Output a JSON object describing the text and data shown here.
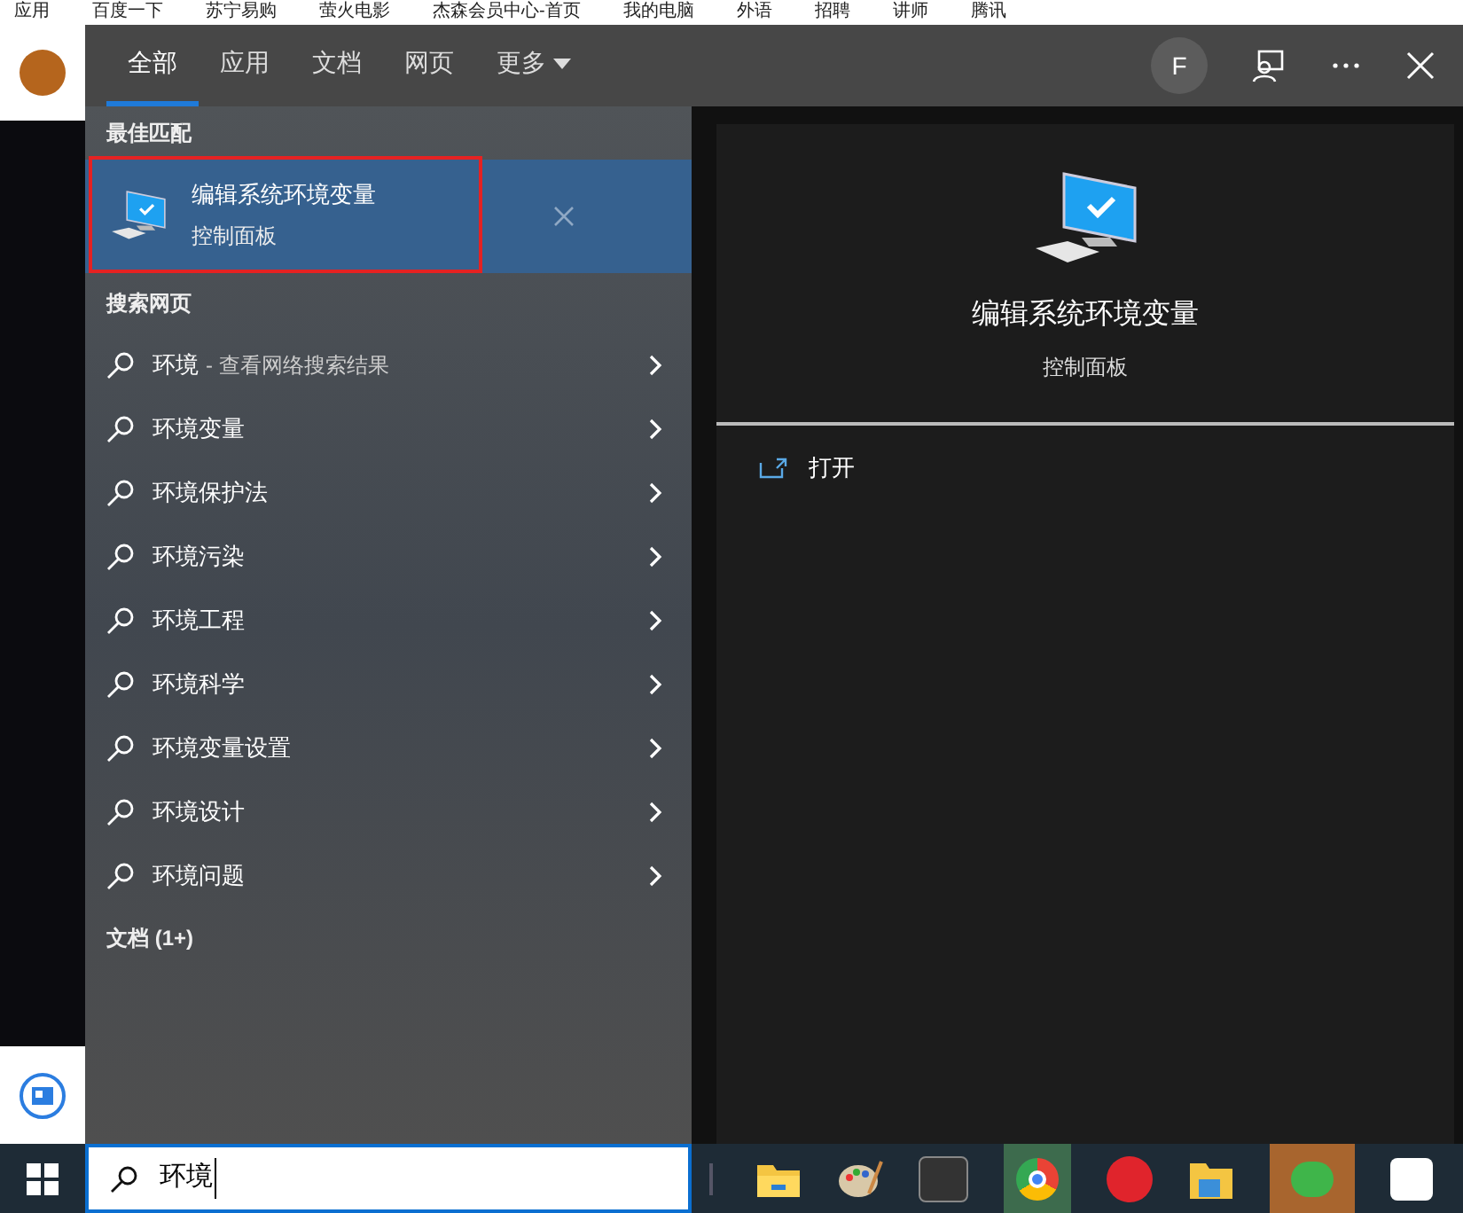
{
  "bookmarks": [
    "应用",
    "百度一下",
    "苏宁易购",
    "萤火电影",
    "杰森会员中心-首页",
    "我的电脑",
    "外语",
    "招聘",
    "讲师",
    "腾讯"
  ],
  "tabs": [
    {
      "label": "全部",
      "selected": true
    },
    {
      "label": "应用",
      "selected": false
    },
    {
      "label": "文档",
      "selected": false
    },
    {
      "label": "网页",
      "selected": false
    },
    {
      "label": "更多",
      "selected": false,
      "dropdown": true
    }
  ],
  "account": {
    "initial": "F"
  },
  "best_match": {
    "heading": "最佳匹配",
    "title": "编辑系统环境变量",
    "subtitle": "控制面板",
    "selected": true
  },
  "web_section": {
    "heading": "搜索网页",
    "items": [
      {
        "text": "环境",
        "hint": "- 查看网络搜索结果"
      },
      {
        "text": "环境变量"
      },
      {
        "text": "环境保护法"
      },
      {
        "text": "环境污染"
      },
      {
        "text": "环境工程"
      },
      {
        "text": "环境科学"
      },
      {
        "text": "环境变量设置"
      },
      {
        "text": "环境设计"
      },
      {
        "text": "环境问题"
      }
    ]
  },
  "docs_section": {
    "heading": "文档 (1+)"
  },
  "preview": {
    "title": "编辑系统环境变量",
    "subtitle": "控制面板",
    "actions": [
      {
        "label": "打开"
      }
    ]
  },
  "search": {
    "value": "环境"
  }
}
